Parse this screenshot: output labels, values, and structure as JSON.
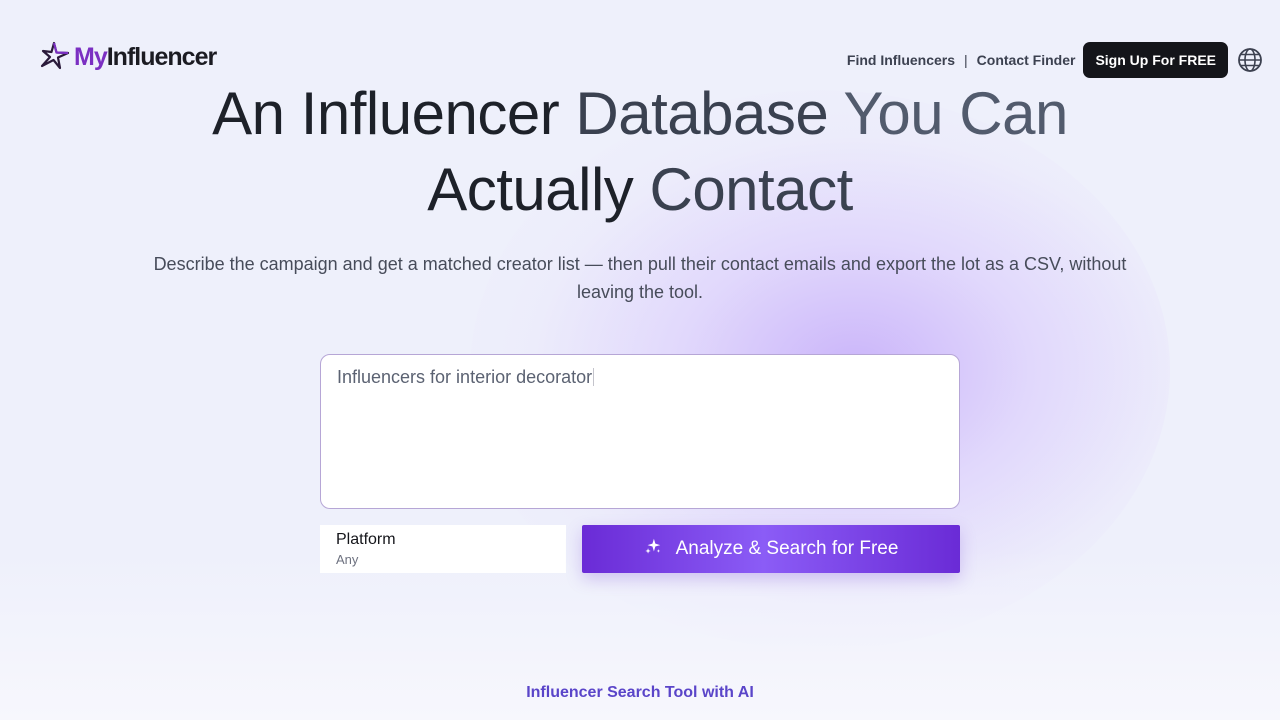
{
  "brand": {
    "logo_my": "My",
    "logo_rest": "Influencer",
    "accent": "#7b2fc2"
  },
  "nav": {
    "find_influencers": "Find Influencers",
    "separator": "|",
    "contact_finder": "Contact Finder",
    "signup": "Sign Up For FREE",
    "language_icon": "globe-icon"
  },
  "hero": {
    "title_part1": "An Influencer",
    "title_part2": "Database",
    "title_part3": "You Can",
    "title_part4": "Actually",
    "title_part5": "Contact",
    "subtitle": "Describe the campaign and get a matched creator list — then pull their contact emails and export the lot as a CSV, without leaving the tool."
  },
  "search": {
    "query_value": "Influencers for interior decorator",
    "platform_label": "Platform",
    "platform_value": "Any",
    "submit_label": "Analyze & Search for Free",
    "submit_icon": "sparkles-icon",
    "button_color": "#6a2bd6"
  },
  "footer": {
    "tagline": "Influencer Search Tool with AI"
  }
}
